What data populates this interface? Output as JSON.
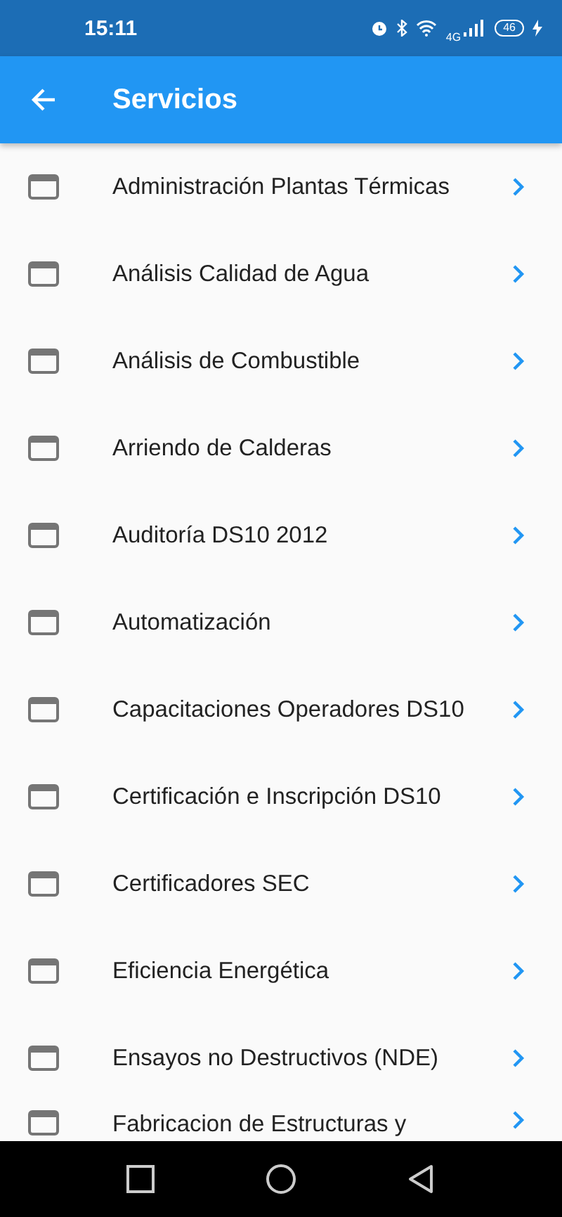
{
  "status_bar": {
    "time": "15:11",
    "network": "4G",
    "battery": "46"
  },
  "app_bar": {
    "title": "Servicios"
  },
  "items": [
    {
      "label": "Administración Plantas Térmicas"
    },
    {
      "label": "Análisis Calidad de Agua"
    },
    {
      "label": "Análisis de Combustible"
    },
    {
      "label": "Arriendo de Calderas"
    },
    {
      "label": "Auditoría DS10 2012"
    },
    {
      "label": "Automatización"
    },
    {
      "label": "Capacitaciones Operadores DS10"
    },
    {
      "label": "Certificación e Inscripción DS10"
    },
    {
      "label": "Certificadores SEC"
    },
    {
      "label": "Eficiencia Energética"
    },
    {
      "label": "Ensayos no Destructivos (NDE)"
    },
    {
      "label": "Fabricacion de Estructuras y"
    }
  ]
}
